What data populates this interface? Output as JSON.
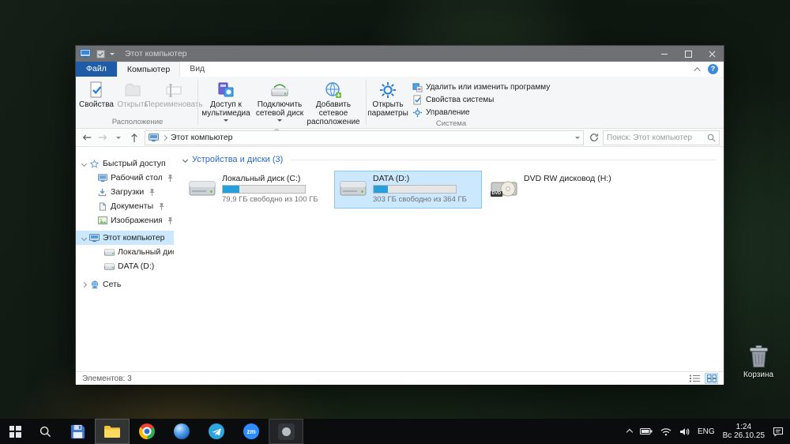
{
  "desktop": {
    "recycle_bin_label": "Корзина"
  },
  "window": {
    "title": "Этот компьютер",
    "tabs": {
      "file": "Файл",
      "computer": "Компьютер",
      "view": "Вид"
    },
    "ribbon": {
      "location": {
        "label": "Расположение",
        "properties": "Свойства",
        "open": "Открыть",
        "rename": "Переименовать"
      },
      "network": {
        "label": "Сеть",
        "media_access": "Доступ к мультимедиа",
        "map_drive": "Подключить сетевой диск",
        "add_location": "Добавить сетевое расположение"
      },
      "system": {
        "label": "Система",
        "open_settings": "Открыть параметры",
        "uninstall": "Удалить или изменить программу",
        "system_properties": "Свойства системы",
        "manage": "Управление"
      }
    },
    "addressbar": {
      "path": "Этот компьютер",
      "search_placeholder": "Поиск: Этот компьютер"
    },
    "sidebar": {
      "quick_access": "Быстрый доступ",
      "desktop": "Рабочий стол",
      "downloads": "Загрузки",
      "documents": "Документы",
      "pictures": "Изображения",
      "this_pc": "Этот компьютер",
      "disk_c": "Локальный диск (C:",
      "disk_d": "DATA (D:)",
      "network": "Сеть"
    },
    "content": {
      "group_header": "Устройства и диски (3)",
      "drives": [
        {
          "name": "Локальный диск (C:)",
          "free_text": "79,9 ГБ свободно из 100 ГБ",
          "used_pct": 20
        },
        {
          "name": "DATA (D:)",
          "free_text": "303 ГБ свободно из 364 ГБ",
          "used_pct": 17
        },
        {
          "name": "DVD RW дисковод (H:)",
          "icon_label": "DVD"
        }
      ]
    },
    "statusbar": {
      "items_count": "Элементов: 3"
    }
  },
  "taskbar": {
    "zoom_label": "zm",
    "tray": {
      "lang": "ENG",
      "time": "1:24",
      "date": "Вс 26.10.25"
    }
  }
}
